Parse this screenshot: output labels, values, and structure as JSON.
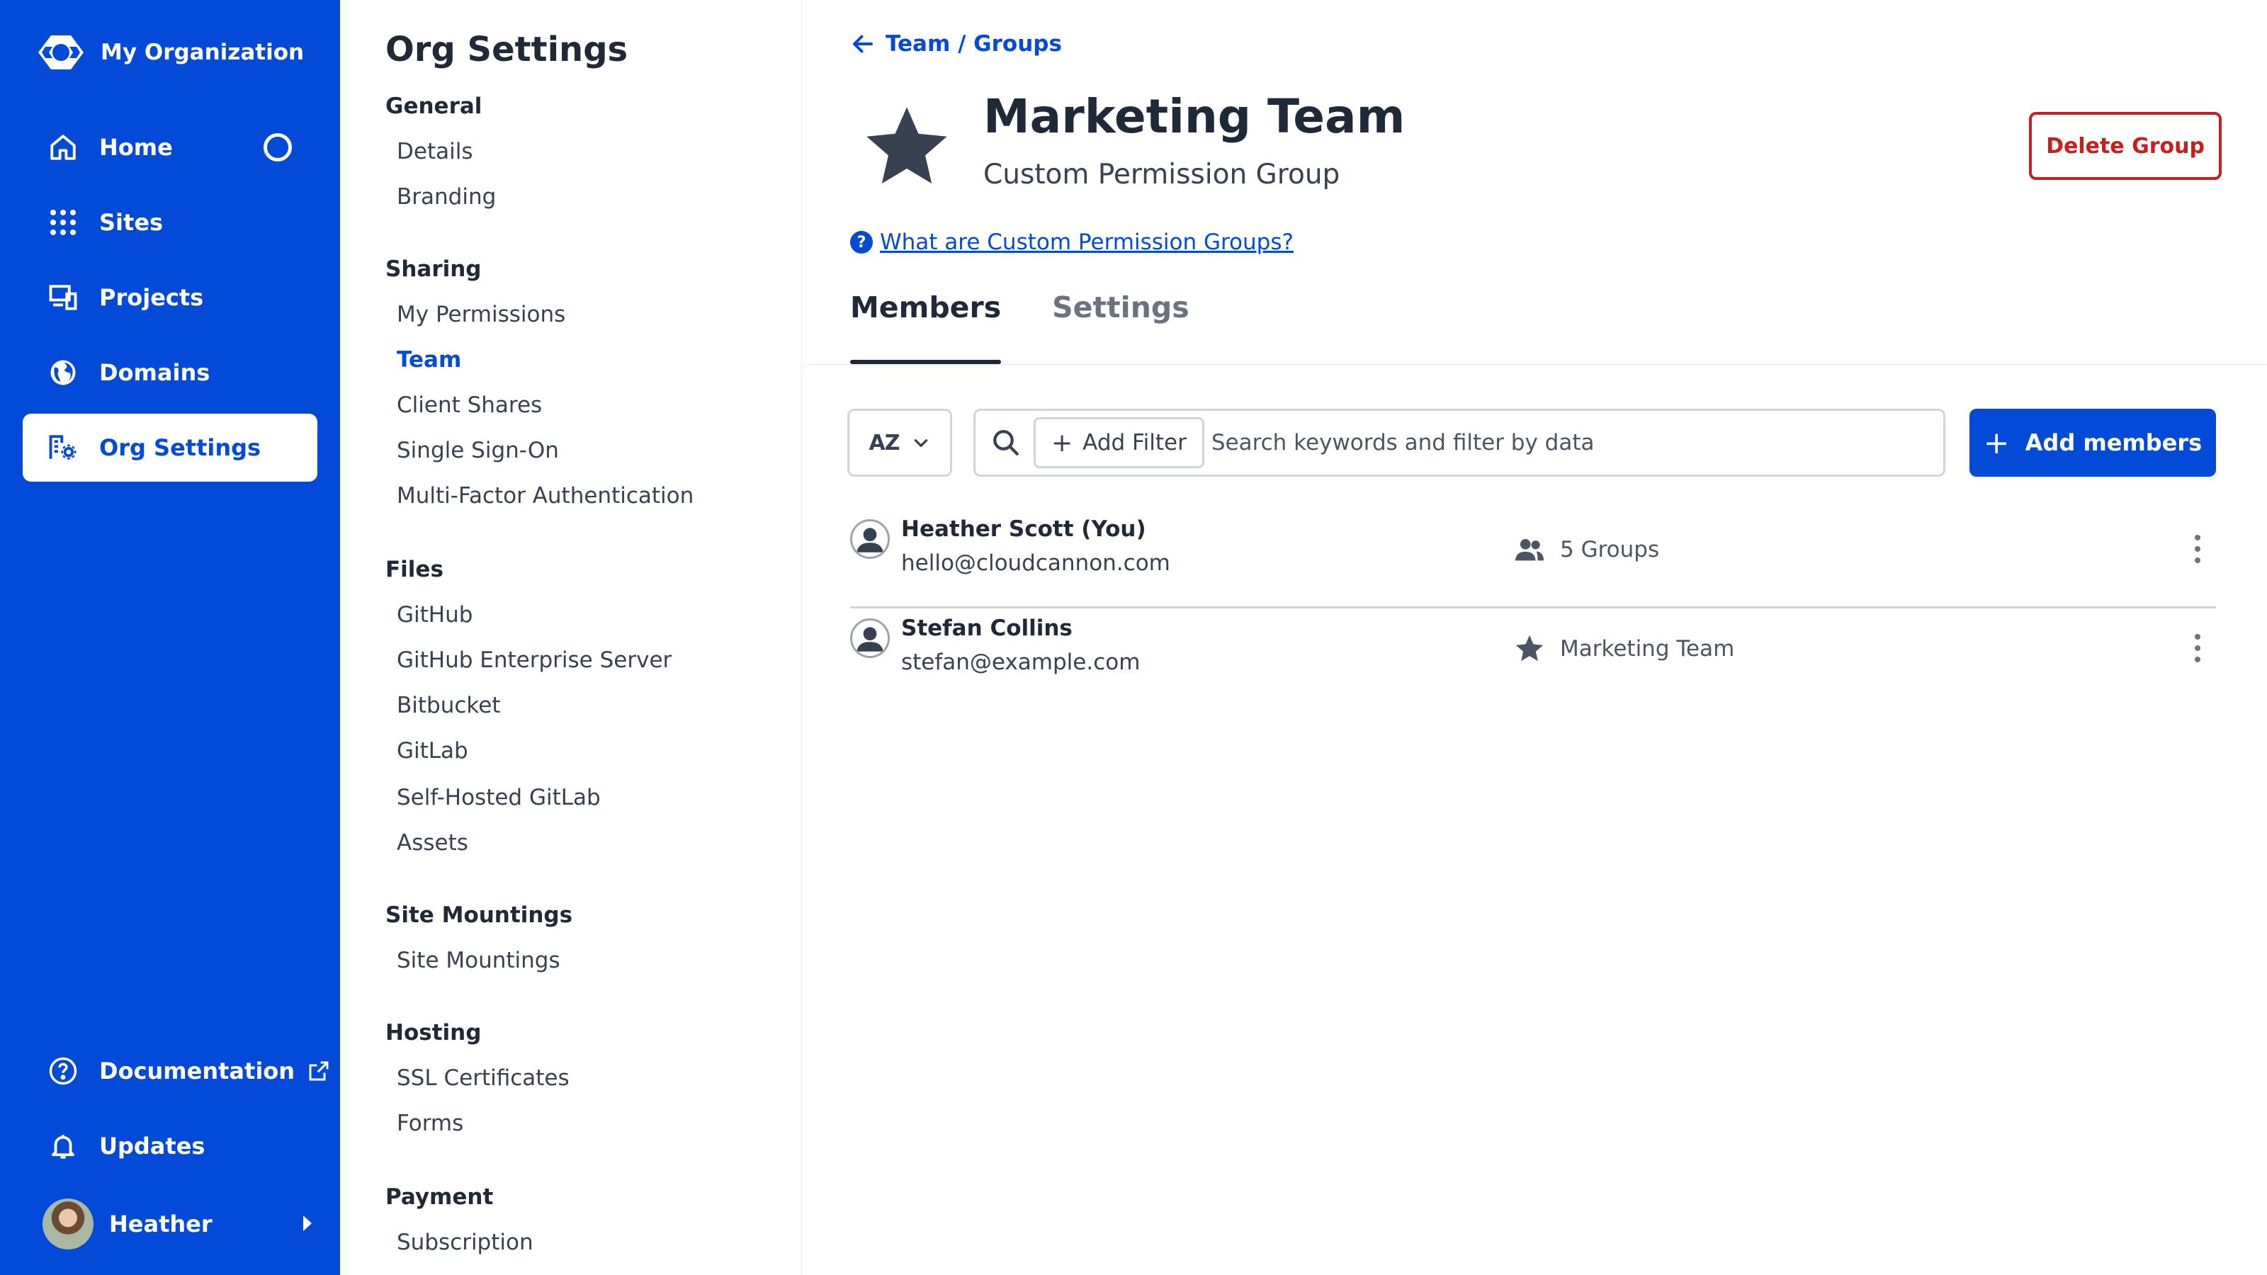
{
  "nav": {
    "org_name": "My Organization",
    "items": [
      {
        "label": "Home",
        "icon": "home-icon"
      },
      {
        "label": "Sites",
        "icon": "grid-icon"
      },
      {
        "label": "Projects",
        "icon": "devices-icon"
      },
      {
        "label": "Domains",
        "icon": "globe-icon"
      },
      {
        "label": "Org Settings",
        "icon": "org-settings-icon",
        "active": true
      }
    ],
    "bottom": [
      {
        "label": "Documentation",
        "icon": "help-circle-icon"
      },
      {
        "label": "Updates",
        "icon": "bell-icon"
      }
    ],
    "user": "Heather",
    "brand_color": "#034ad8"
  },
  "settings": {
    "title": "Org Settings",
    "sections": [
      {
        "heading": "General",
        "items": [
          "Details",
          "Branding"
        ]
      },
      {
        "heading": "Sharing",
        "items": [
          "My Permissions",
          "Team",
          "Client Shares",
          "Single Sign-On",
          "Multi-Factor Authentication"
        ]
      },
      {
        "heading": "Files",
        "items": [
          "GitHub",
          "GitHub Enterprise Server",
          "Bitbucket",
          "GitLab",
          "Self-Hosted GitLab",
          "Assets"
        ]
      },
      {
        "heading": "Site Mountings",
        "items": [
          "Site Mountings"
        ]
      },
      {
        "heading": "Hosting",
        "items": [
          "SSL Certificates",
          "Forms"
        ]
      },
      {
        "heading": "Payment",
        "items": [
          "Subscription"
        ]
      }
    ],
    "active_item": "Team"
  },
  "main": {
    "breadcrumb": "Team / Groups",
    "title": "Marketing Team",
    "subtitle": "Custom Permission Group",
    "delete_label": "Delete Group",
    "help_link": "What are Custom Permission Groups?",
    "tabs": [
      {
        "label": "Members",
        "active": true
      },
      {
        "label": "Settings",
        "active": false
      }
    ],
    "toolbar": {
      "sort_label": "AZ",
      "add_filter_label": "Add Filter",
      "search_placeholder": "Search keywords and filter by data",
      "add_members_label": "Add members"
    },
    "members": [
      {
        "name": "Heather Scott (You)",
        "email": "hello@cloudcannon.com",
        "meta": "5 Groups",
        "meta_icon": "users-icon"
      },
      {
        "name": "Stefan Collins",
        "email": "stefan@example.com",
        "meta": "Marketing Team",
        "meta_icon": "star-icon"
      }
    ],
    "danger_color": "#c81e1e"
  }
}
